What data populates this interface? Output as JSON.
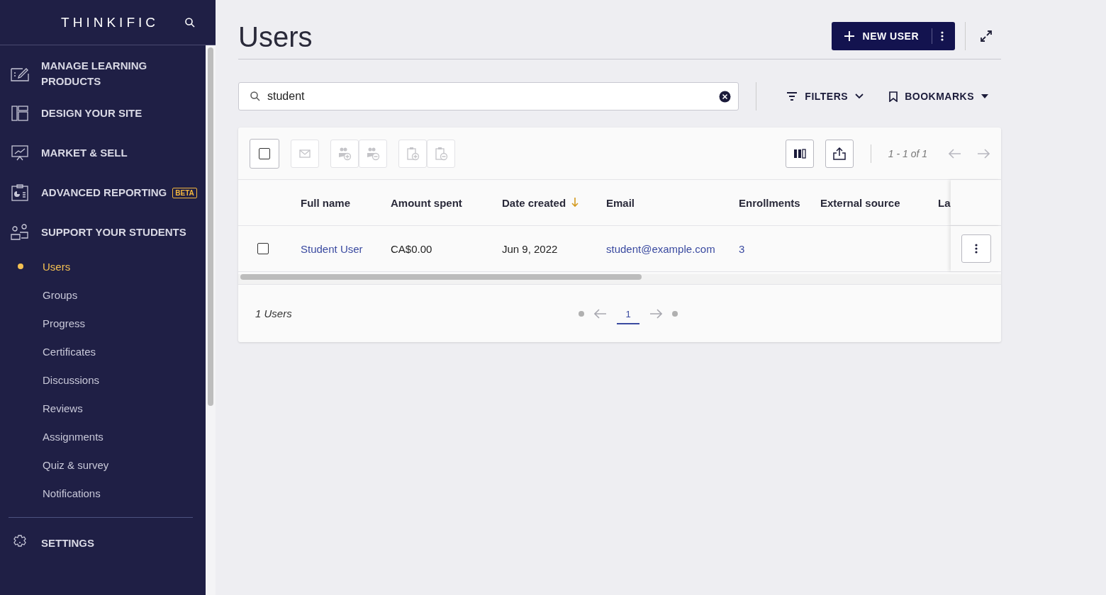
{
  "sidebar": {
    "logo": "THINKIFIC",
    "nav": [
      {
        "label": "MANAGE LEARNING PRODUCTS"
      },
      {
        "label": "DESIGN YOUR SITE"
      },
      {
        "label": "MARKET & SELL"
      },
      {
        "label": "ADVANCED REPORTING",
        "badge": "BETA"
      },
      {
        "label": "SUPPORT YOUR STUDENTS",
        "children": [
          {
            "label": "Users",
            "selected": true
          },
          {
            "label": "Groups",
            "selected": false
          },
          {
            "label": "Progress",
            "selected": false
          },
          {
            "label": "Certificates",
            "selected": false
          },
          {
            "label": "Discussions",
            "selected": false
          },
          {
            "label": "Reviews",
            "selected": false
          },
          {
            "label": "Assignments",
            "selected": false
          },
          {
            "label": "Quiz & survey",
            "selected": false
          },
          {
            "label": "Notifications",
            "selected": false
          }
        ]
      }
    ],
    "bottom_nav": [
      {
        "label": "SETTINGS"
      }
    ]
  },
  "page": {
    "title": "Users",
    "new_button": "NEW USER"
  },
  "search": {
    "value": "student"
  },
  "filters": "FILTERS",
  "bookmarks": "BOOKMARKS",
  "toolbar": {
    "select_all": {
      "checked": false
    },
    "bulk_actions": [
      {
        "disabled": true
      },
      {
        "disabled": true
      },
      {
        "disabled": true
      },
      {
        "disabled": true
      },
      {
        "disabled": true
      }
    ],
    "range": "1 - 1 of 1"
  },
  "table": {
    "columns": [
      {
        "label": "Full name",
        "sorted": false
      },
      {
        "label": "Amount spent",
        "sorted": false
      },
      {
        "label": "Date created",
        "sorted": true
      },
      {
        "label": "Email",
        "sorted": false
      },
      {
        "label": "Enrollments",
        "sorted": false
      },
      {
        "label": "External source",
        "sorted": false
      },
      {
        "label": "La",
        "sorted": false
      }
    ],
    "rows": [
      {
        "selected": false,
        "cells": [
          {
            "text": "Student User",
            "kind": "link"
          },
          {
            "text": "CA$0.00",
            "kind": "text"
          },
          {
            "text": "Jun 9, 2022",
            "kind": "text"
          },
          {
            "text": "student@example.com",
            "kind": "link"
          },
          {
            "text": "3",
            "kind": "link"
          }
        ]
      }
    ]
  },
  "footer": {
    "count": "1 Users",
    "pages": [
      {
        "label": "1",
        "selected": true
      }
    ]
  }
}
